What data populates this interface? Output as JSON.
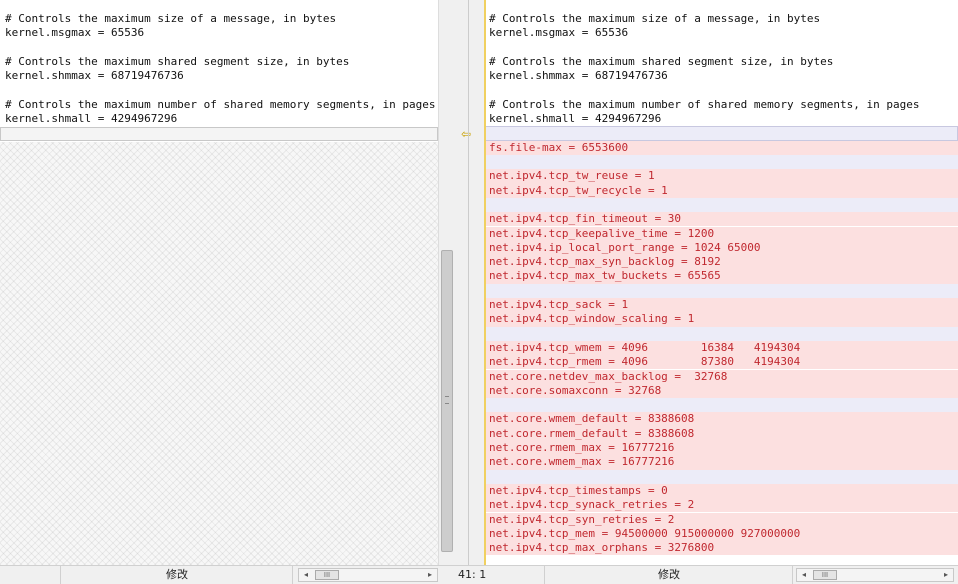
{
  "left_pane": {
    "lines": [
      "# Controls the maximum size of a message, in bytes",
      "kernel.msgmax = 65536",
      "",
      "# Controls the maximum shared segment size, in bytes",
      "kernel.shmmax = 68719476736",
      "",
      "# Controls the maximum number of shared memory segments, in pages",
      "kernel.shmall = 4294967296"
    ]
  },
  "right_pane": {
    "common_lines": [
      "# Controls the maximum size of a message, in bytes",
      "kernel.msgmax = 65536",
      "",
      "# Controls the maximum shared segment size, in bytes",
      "kernel.shmmax = 68719476736",
      "",
      "# Controls the maximum number of shared memory segments, in pages",
      "kernel.shmall = 4294967296"
    ],
    "added_lines": [
      "fs.file-max = 6553600",
      "",
      "net.ipv4.tcp_tw_reuse = 1",
      "net.ipv4.tcp_tw_recycle = 1",
      "",
      "net.ipv4.tcp_fin_timeout = 30",
      "net.ipv4.tcp_keepalive_time = 1200",
      "net.ipv4.ip_local_port_range = 1024 65000",
      "net.ipv4.tcp_max_syn_backlog = 8192",
      "net.ipv4.tcp_max_tw_buckets = 65565",
      "",
      "net.ipv4.tcp_sack = 1",
      "net.ipv4.tcp_window_scaling = 1",
      "",
      "net.ipv4.tcp_wmem = 4096        16384   4194304",
      "net.ipv4.tcp_rmem = 4096        87380   4194304",
      "net.core.netdev_max_backlog =  32768",
      "net.core.somaxconn = 32768",
      "",
      "net.core.wmem_default = 8388608",
      "net.core.rmem_default = 8388608",
      "net.core.rmem_max = 16777216",
      "net.core.wmem_max = 16777216",
      "",
      "net.ipv4.tcp_timestamps = 0",
      "net.ipv4.tcp_synack_retries = 2",
      "net.ipv4.tcp_syn_retries = 2",
      "net.ipv4.tcp_mem = 94500000 915000000 927000000",
      "net.ipv4.tcp_max_orphans = 3276800"
    ]
  },
  "status_bar": {
    "left_mode": "修改",
    "right_cursor": "41: 1",
    "right_mode": "修改",
    "scroll_left_arrow": "◂",
    "scroll_right_arrow": "▸",
    "scroll_grip": "III"
  },
  "divider": {
    "change_arrow_icon": "⇦"
  },
  "colors": {
    "added_bg": "#fce0e0",
    "added_text": "#c0282f",
    "gap_bg": "#ececf8"
  }
}
